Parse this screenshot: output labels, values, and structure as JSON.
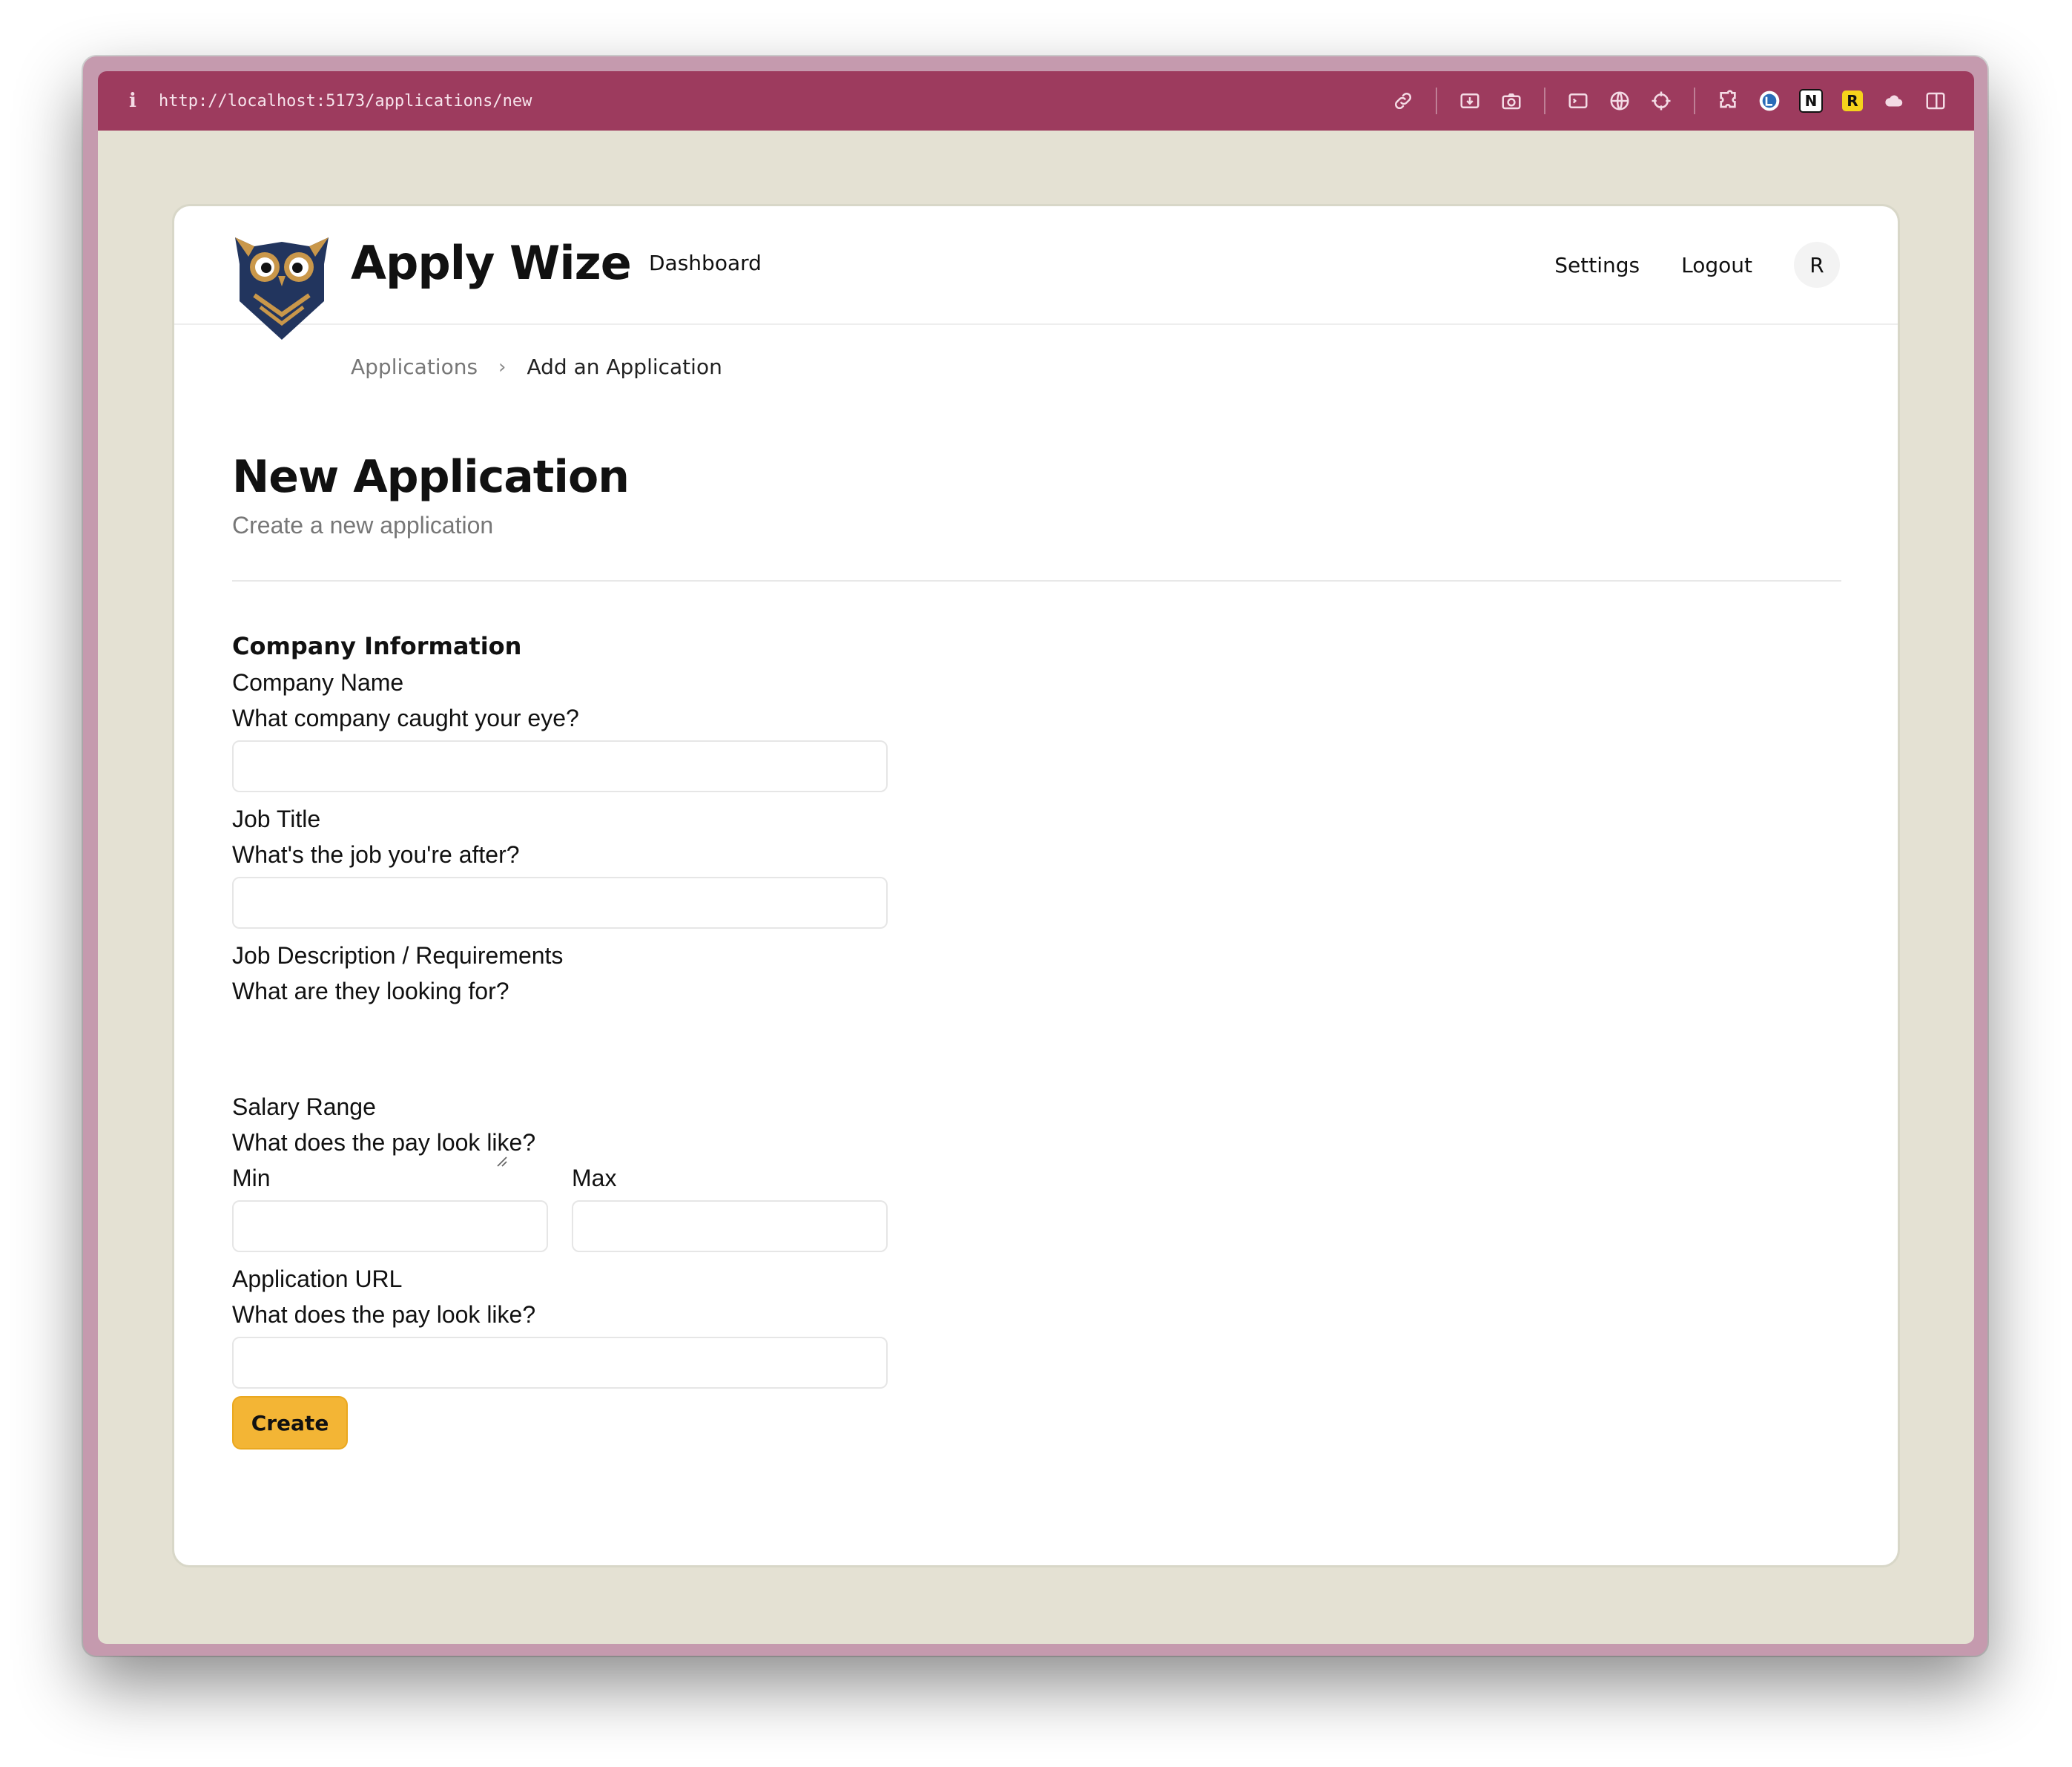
{
  "browser": {
    "url": "http://localhost:5173/applications/new",
    "info_glyph": "i",
    "extension_badges": {
      "notion": "N",
      "readwise": "R"
    },
    "icons": [
      "link-icon",
      "screen-capture-icon",
      "camera-icon",
      "terminal-icon",
      "globe-icon",
      "crosshair-icon",
      "puzzle-icon",
      "lastpass-icon",
      "notion-icon",
      "readwise-icon",
      "cloud-icon",
      "sidebar-icon"
    ]
  },
  "header": {
    "brand": "Apply Wize",
    "nav": {
      "dashboard": "Dashboard",
      "settings": "Settings",
      "logout": "Logout"
    },
    "avatar_initial": "R"
  },
  "breadcrumb": {
    "parent": "Applications",
    "separator": "›",
    "current": "Add an Application"
  },
  "page": {
    "title": "New Application",
    "subtitle": "Create a new application"
  },
  "form": {
    "section_heading": "Company Information",
    "company_name": {
      "label": "Company Name",
      "help": "What company caught your eye?",
      "value": ""
    },
    "job_title": {
      "label": "Job Title",
      "help": "What's the job you're after?",
      "value": ""
    },
    "job_description": {
      "label": "Job Description / Requirements",
      "help": "What are they looking for?",
      "value": ""
    },
    "salary": {
      "label": "Salary Range",
      "help": "What does the pay look like?",
      "min_label": "Min",
      "max_label": "Max",
      "min_value": "",
      "max_value": ""
    },
    "application_url": {
      "label": "Application URL",
      "help": "What does the pay look like?",
      "value": ""
    },
    "submit_label": "Create"
  },
  "colors": {
    "toolbar": "#9d3b5e",
    "viewport_bg": "#e4e1d3",
    "accent_button": "#f3b535",
    "logo_navy": "#22355e",
    "logo_gold": "#c9974a"
  }
}
